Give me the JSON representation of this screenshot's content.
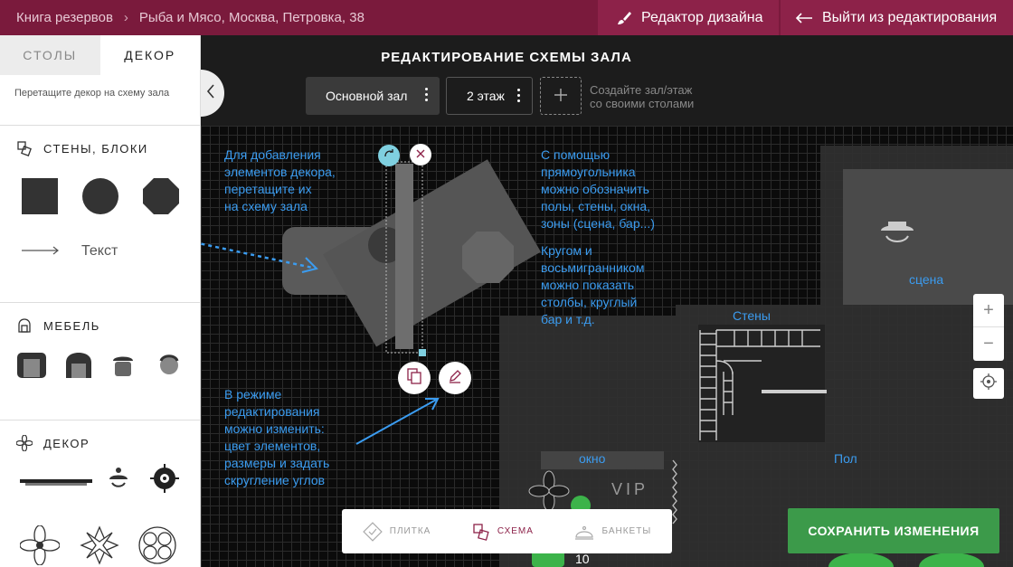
{
  "breadcrumb": {
    "root": "Книга резервов",
    "separator": "›",
    "venue": "Рыба и Мясо, Москва, Петровка, 38"
  },
  "top_buttons": {
    "design_editor": "Редактор дизайна",
    "exit_edit": "Выйти из редактирования"
  },
  "left_panel": {
    "tabs": [
      {
        "label": "СТОЛЫ",
        "active": false
      },
      {
        "label": "ДЕКОР",
        "active": true
      }
    ],
    "hint": "Перетащите декор на схему зала",
    "sections": {
      "walls": {
        "title": "СТЕНЫ, БЛОКИ",
        "text_item": "Текст"
      },
      "furniture": {
        "title": "МЕБЕЛЬ"
      },
      "decor": {
        "title": "ДЕКОР"
      }
    }
  },
  "canvas": {
    "title": "РЕДАКТИРОВАНИЕ СХЕМЫ ЗАЛА",
    "hall": "Основной зал",
    "floor": "2 этаж",
    "add_hint_line1": "Создайте зал/этаж",
    "add_hint_line2": "со своими столами",
    "notes": {
      "drag": [
        "Для добавления",
        "элементов декора,",
        "перетащите их",
        "на схему зала"
      ],
      "rect": [
        "С помощью",
        "прямоугольника",
        "можно обозначить",
        "полы, стены, окна,",
        "зоны (сцена, бар...)"
      ],
      "circle": [
        "Кругом и",
        "восьмигранником",
        "можно показать",
        "столбы, круглый",
        "бар и т.д."
      ],
      "edit": [
        "В режиме",
        "редактирования",
        "можно изменить:",
        "цвет элементов,",
        "размеры и задать",
        "скругление углов"
      ]
    },
    "labels": {
      "stage": "сцена",
      "walls": "Стены",
      "window": "окно",
      "floor_label": "Пол",
      "vip": "VIP",
      "table_number": "10"
    },
    "zoom": {
      "plus": "+",
      "minus": "−"
    }
  },
  "modes": [
    {
      "label": "ПЛИТКА",
      "icon": "tile-icon",
      "active": false
    },
    {
      "label": "СХЕМА",
      "icon": "scheme-icon",
      "active": true
    },
    {
      "label": "БАНКЕТЫ",
      "icon": "banquet-icon",
      "active": false
    }
  ],
  "save_button": "СОХРАНИТЬ ИЗМЕНЕНИЯ",
  "colors": {
    "brand": "#7a1a3c",
    "accent_blue": "#3b9cf0",
    "save_green": "#3c9a4a",
    "selection": "#7fd0e0"
  }
}
